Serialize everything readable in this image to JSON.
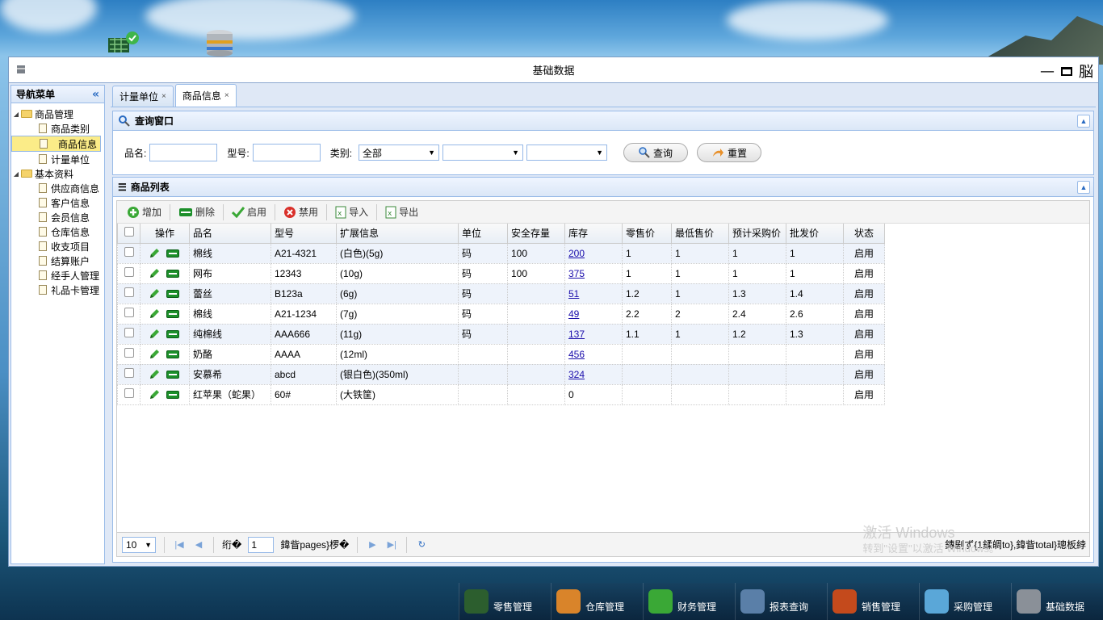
{
  "window": {
    "title": "基础数据",
    "controls": [
      "—",
      "□",
      "脳"
    ]
  },
  "sidebar": {
    "title": "导航菜单",
    "collapse": "«",
    "groups": [
      {
        "label": "商品管理",
        "items": [
          "商品类别",
          "商品信息",
          "计量单位"
        ]
      },
      {
        "label": "基本资料",
        "items": [
          "供应商信息",
          "客户信息",
          "会员信息",
          "仓库信息",
          "收支项目",
          "结算账户",
          "经手人管理",
          "礼品卡管理"
        ]
      }
    ],
    "selected": "商品信息"
  },
  "tabs": [
    {
      "label": "计量单位",
      "close": "×"
    },
    {
      "label": "商品信息",
      "close": "×"
    }
  ],
  "query": {
    "title": "查询窗口",
    "name_label": "品名:",
    "model_label": "型号:",
    "category_label": "类别:",
    "category_value": "全部",
    "search_btn": "查询",
    "reset_btn": "重置"
  },
  "list": {
    "title": "商品列表",
    "toolbar": {
      "add": "增加",
      "delete": "删除",
      "enable": "启用",
      "disable": "禁用",
      "import": "导入",
      "export": "导出"
    },
    "columns": [
      "操作",
      "品名",
      "型号",
      "扩展信息",
      "单位",
      "安全存量",
      "库存",
      "零售价",
      "最低售价",
      "预计采购价",
      "批发价",
      "状态"
    ],
    "rows": [
      {
        "name": "棉线",
        "model": "A21-4321",
        "ext": "(白色)(5g)",
        "unit": "码",
        "safety": "100",
        "stock": "200",
        "retail": "1",
        "min": "1",
        "purchase": "1",
        "wholesale": "1",
        "status": "启用"
      },
      {
        "name": "网布",
        "model": "12343",
        "ext": "(10g)",
        "unit": "码",
        "safety": "100",
        "stock": "375",
        "retail": "1",
        "min": "1",
        "purchase": "1",
        "wholesale": "1",
        "status": "启用"
      },
      {
        "name": "蕾丝",
        "model": "B123a",
        "ext": "(6g)",
        "unit": "码",
        "safety": "",
        "stock": "51",
        "retail": "1.2",
        "min": "1",
        "purchase": "1.3",
        "wholesale": "1.4",
        "status": "启用"
      },
      {
        "name": "棉线",
        "model": "A21-1234",
        "ext": "(7g)",
        "unit": "码",
        "safety": "",
        "stock": "49",
        "retail": "2.2",
        "min": "2",
        "purchase": "2.4",
        "wholesale": "2.6",
        "status": "启用"
      },
      {
        "name": "纯棉线",
        "model": "AAA666",
        "ext": "(11g)",
        "unit": "码",
        "safety": "",
        "stock": "137",
        "retail": "1.1",
        "min": "1",
        "purchase": "1.2",
        "wholesale": "1.3",
        "status": "启用"
      },
      {
        "name": "奶酪",
        "model": "AAAA",
        "ext": "(12ml)",
        "unit": "",
        "safety": "",
        "stock": "456",
        "retail": "",
        "min": "",
        "purchase": "",
        "wholesale": "",
        "status": "启用"
      },
      {
        "name": "安慕希",
        "model": "abcd",
        "ext": "(银白色)(350ml)",
        "unit": "",
        "safety": "",
        "stock": "324",
        "retail": "",
        "min": "",
        "purchase": "",
        "wholesale": "",
        "status": "启用"
      },
      {
        "name": "红苹果（蛇果）",
        "model": "60#",
        "ext": "(大铁筐)",
        "unit": "",
        "safety": "",
        "stock": "0",
        "retail": "",
        "min": "",
        "purchase": "",
        "wholesale": "",
        "status": "启用"
      }
    ]
  },
  "pager": {
    "page_size": "10",
    "before_page": "绗�",
    "page": "1",
    "after_page": "鍏眥pages}椤�",
    "info": "鏄剧ず{1鍒皗to},鍏眥total}璁板綍"
  },
  "watermark": {
    "line1": "激活 Windows",
    "line2": "转到\"设置\"以激活 Windows。"
  },
  "taskbar": [
    {
      "label": "零售管理",
      "icon": "cart-icon",
      "color": "#2c5e2e"
    },
    {
      "label": "仓库管理",
      "icon": "boxes-icon",
      "color": "#d9842a"
    },
    {
      "label": "财务管理",
      "icon": "yen-icon",
      "color": "#3aa836"
    },
    {
      "label": "报表查询",
      "icon": "report-icon",
      "color": "#5a7fa8"
    },
    {
      "label": "销售管理",
      "icon": "sale-icon",
      "color": "#c44a1c"
    },
    {
      "label": "采购管理",
      "icon": "buy-now-icon",
      "color": "#5aa7d8"
    },
    {
      "label": "基础数据",
      "icon": "database-icon",
      "color": "#8a9098"
    }
  ]
}
